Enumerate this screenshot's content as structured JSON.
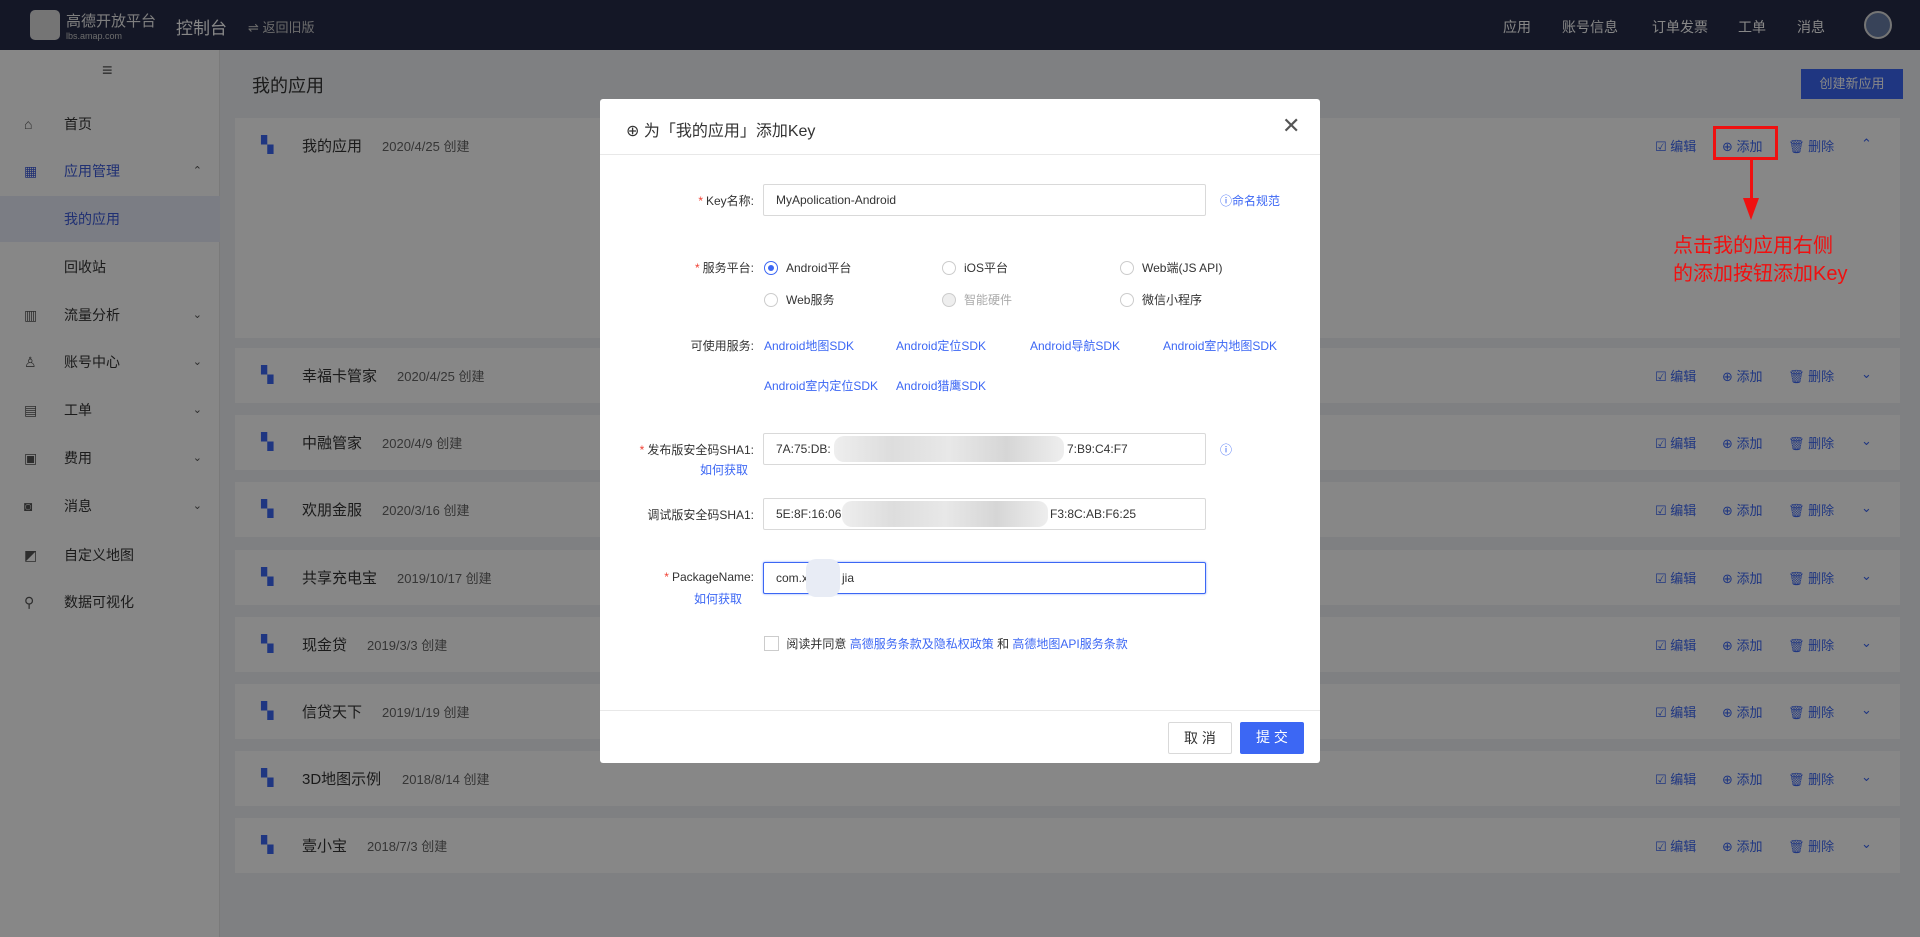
{
  "nav": {
    "brand": "高德开放平台",
    "brand_sub": "lbs.amap.com",
    "console": "控制台",
    "back": "返回旧版",
    "menu": [
      "应用",
      "账号信息",
      "订单发票",
      "工单",
      "消息"
    ]
  },
  "sidebar": {
    "toggle": "≡",
    "items": [
      {
        "label": "首页",
        "icon": "⌂"
      },
      {
        "label": "应用管理",
        "icon": "▦",
        "chev": "⌃"
      },
      {
        "label": "我的应用"
      },
      {
        "label": "回收站"
      },
      {
        "label": "流量分析",
        "icon": "▥",
        "chev": "⌄"
      },
      {
        "label": "账号中心",
        "icon": "♙",
        "chev": "⌄"
      },
      {
        "label": "工单",
        "icon": "▤",
        "chev": "⌄"
      },
      {
        "label": "费用",
        "icon": "▣",
        "chev": "⌄"
      },
      {
        "label": "消息",
        "icon": "◙",
        "chev": "⌄"
      },
      {
        "label": "自定义地图",
        "icon": "◩"
      },
      {
        "label": "数据可视化",
        "icon": "⚲"
      }
    ]
  },
  "page": {
    "title": "我的应用",
    "create": "创建新应用"
  },
  "actions": {
    "edit": "编辑",
    "add": "添加",
    "delete": "删除"
  },
  "apps": [
    {
      "name": "我的应用",
      "date": "2020/4/25 创建"
    },
    {
      "name": "幸福卡管家",
      "date": "2020/4/25 创建"
    },
    {
      "name": "中融管家",
      "date": "2020/4/9 创建"
    },
    {
      "name": "欢朋金服",
      "date": "2020/3/16 创建"
    },
    {
      "name": "共享充电宝",
      "date": "2019/10/17 创建"
    },
    {
      "name": "现金贷",
      "date": "2019/3/3 创建"
    },
    {
      "name": "信贷天下",
      "date": "2019/1/19 创建"
    },
    {
      "name": "3D地图示例",
      "date": "2018/8/14 创建"
    },
    {
      "name": "壹小宝",
      "date": "2018/7/3 创建"
    }
  ],
  "annotation": {
    "line1": "点击我的应用右侧",
    "line2": "的添加按钮添加Key"
  },
  "modal": {
    "title": "为「我的应用」添加Key",
    "key_label": "Key名称:",
    "key_value": "MyApolication-Android",
    "naming": "命名规范",
    "platform_label": "服务平台:",
    "platforms": [
      "Android平台",
      "iOS平台",
      "Web端(JS API)",
      "Web服务",
      "智能硬件",
      "微信小程序"
    ],
    "services_label": "可使用服务:",
    "services": [
      "Android地图SDK",
      "Android定位SDK",
      "Android导航SDK",
      "Android室内地图SDK",
      "Android室内定位SDK",
      "Android猎鹰SDK"
    ],
    "release_label": "发布版安全码SHA1:",
    "release_prefix": "7A:75:DB:",
    "release_suffix": "7:B9:C4:F7",
    "how": "如何获取",
    "debug_label": "调试版安全码SHA1:",
    "debug_prefix": "5E:8F:16:06",
    "debug_suffix": "F3:8C:AB:F6:25",
    "pkg_label": "PackageName:",
    "pkg_prefix": "com.x",
    "pkg_suffix": "jia",
    "agree": "阅读并同意",
    "terms1": "高德服务条款及隐私权政策",
    "and": "和",
    "terms2": "高德地图API服务条款",
    "cancel": "取 消",
    "submit": "提 交"
  }
}
